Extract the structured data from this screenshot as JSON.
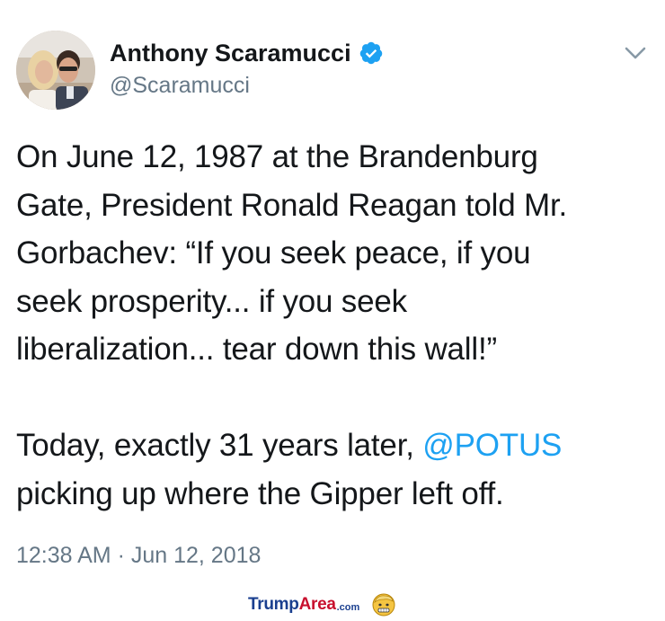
{
  "author": {
    "display_name": "Anthony Scaramucci",
    "handle": "@Scaramucci",
    "verified": true,
    "avatar_icon": "profile-photo",
    "verified_icon": "verified-badge-icon",
    "menu_icon": "chevron-down-icon"
  },
  "tweet": {
    "paragraph1": [
      "On June 12, 1987 at the Brandenburg",
      "Gate, President Ronald Reagan told Mr.",
      "Gorbachev: “If you seek peace, if you",
      "seek prosperity... if you seek",
      "liberalization... tear down this wall!”"
    ],
    "paragraph2_line1_prefix": "Today, exactly 31 years later, ",
    "paragraph2_mention": "@POTUS",
    "paragraph2_line2": "picking up where the Gipper left off.",
    "timestamp": "12:38 AM · Jun 12, 2018"
  },
  "watermark": {
    "part1": "Trump",
    "part2": "Area",
    "part3": ".com",
    "icon": "trump-face-icon"
  },
  "colors": {
    "text": "#14171a",
    "secondary": "#657786",
    "link": "#1da1f2",
    "verified": "#1da1f2",
    "watermark_blue": "#1a3f8f",
    "watermark_red": "#c8102e"
  }
}
